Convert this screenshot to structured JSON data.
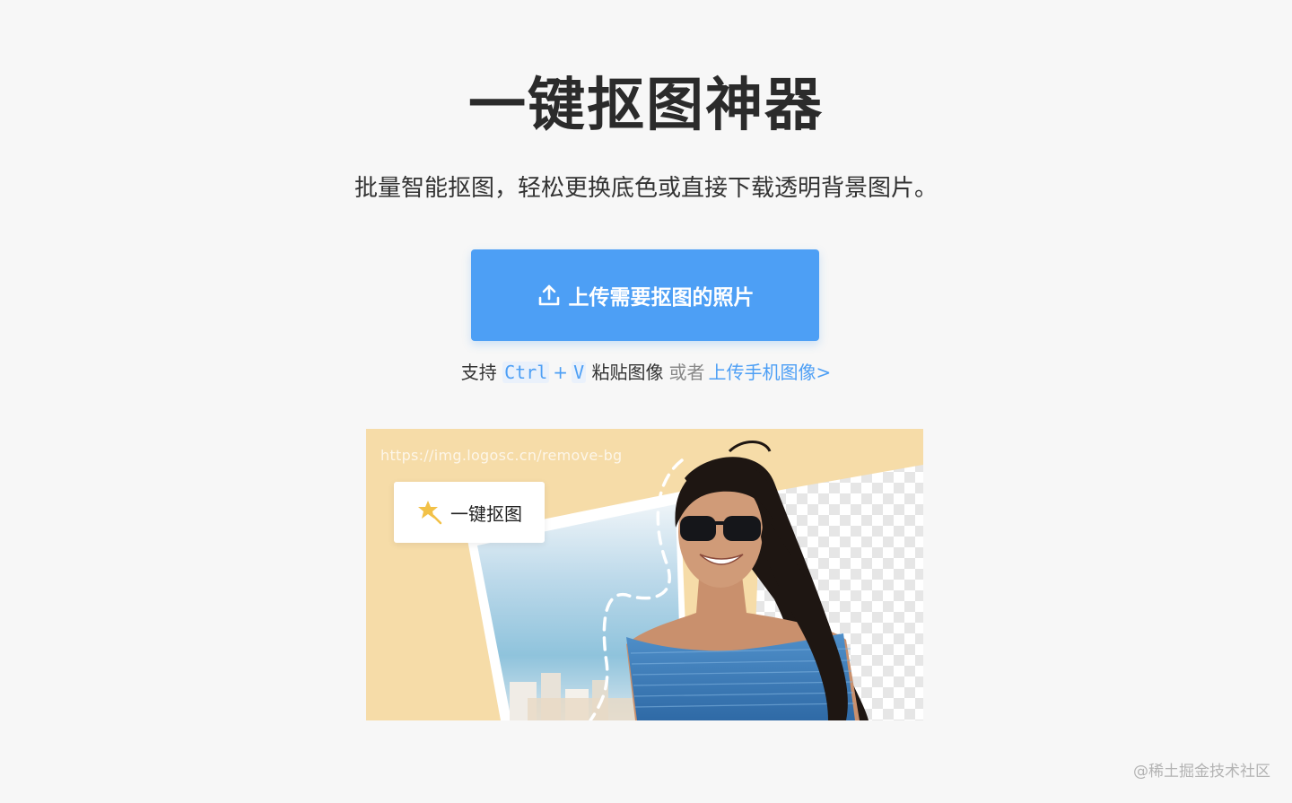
{
  "hero": {
    "title": "一键抠图神器",
    "subtitle": "批量智能抠图，轻松更换底色或直接下载透明背景图片。"
  },
  "upload": {
    "icon": "upload-icon",
    "label": "上传需要抠图的照片"
  },
  "hint": {
    "prefix": "支持",
    "key1": "Ctrl",
    "plus": "+",
    "key2": "V",
    "action": "粘贴图像",
    "or": "或者",
    "mobile_link": "上传手机图像>"
  },
  "demo": {
    "url_text": "https://img.logosc.cn/remove-bg",
    "badge_label": "一键抠图",
    "badge_icon": "magic-star-icon"
  },
  "watermark": "@稀土掘金技术社区",
  "colors": {
    "accent": "#4d9ff5",
    "background": "#f7f7f7",
    "demo_background": "#f6dca8"
  }
}
